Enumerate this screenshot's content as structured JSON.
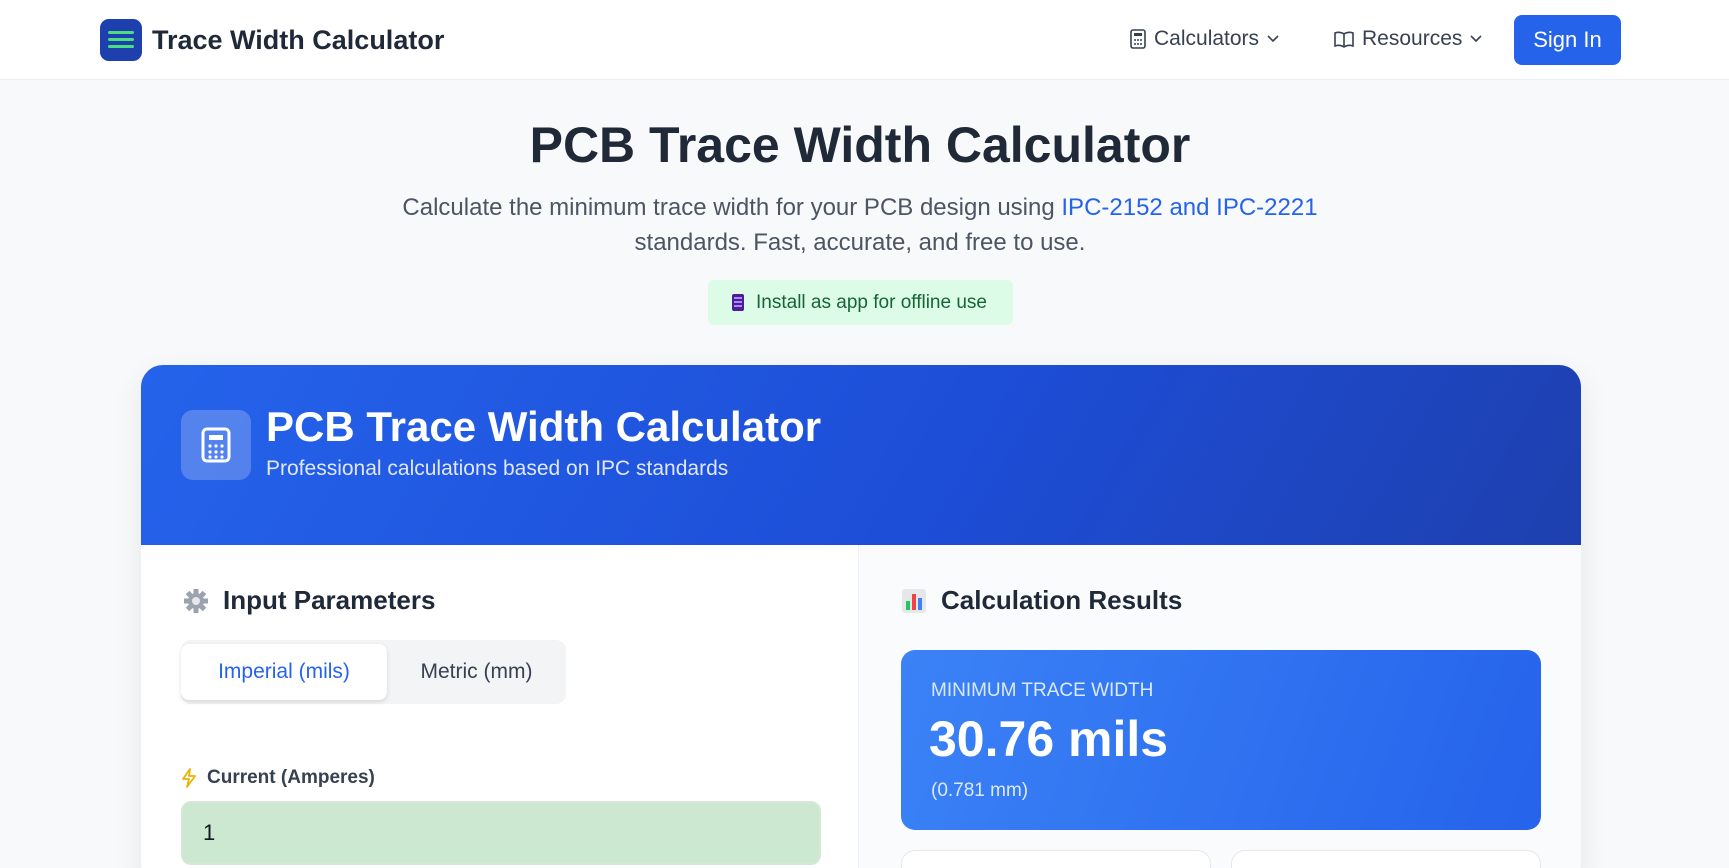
{
  "header": {
    "brand_name": "Trace Width Calculator",
    "nav": [
      {
        "label": "Calculators"
      },
      {
        "label": "Resources"
      }
    ],
    "sign_in_label": "Sign In"
  },
  "hero": {
    "title": "PCB Trace Width Calculator",
    "subtitle_before": "Calculate the minimum trace width for your PCB design using ",
    "subtitle_link": "IPC-2152 and IPC-2221",
    "subtitle_after": " standards. Fast, accurate, and free to use.",
    "install_label": "Install as app for offline use"
  },
  "calculator": {
    "title": "PCB Trace Width Calculator",
    "subtitle": "Professional calculations based on IPC standards",
    "inputs": {
      "section_title": "Input Parameters",
      "unit_options": [
        "Imperial (mils)",
        "Metric (mm)"
      ],
      "selected_unit": "Imperial (mils)",
      "current_label": "Current (Amperes)",
      "current_value": "1"
    },
    "results": {
      "section_title": "Calculation Results",
      "min_width_label": "Minimum Trace Width",
      "min_width_value": "30.76 mils",
      "min_width_metric": "(0.781 mm)"
    }
  },
  "colors": {
    "primary": "#2563eb",
    "header_gradient_end": "#1e40af",
    "install_bg": "#dcfce7",
    "input_bg": "#cce8d0"
  }
}
